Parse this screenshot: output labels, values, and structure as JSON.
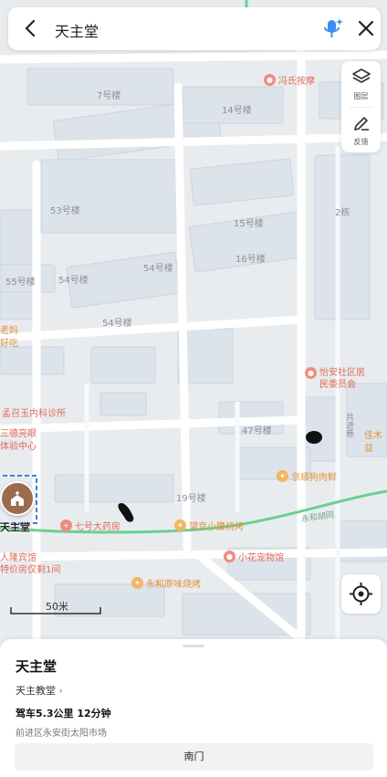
{
  "search": {
    "title": "天主堂"
  },
  "side_panel": {
    "layers_label": "图层",
    "feedback_label": "反馈"
  },
  "map": {
    "building_labels": [
      "7号楼",
      "14号楼",
      "53号楼",
      "15号楼",
      "2栋",
      "16号楼",
      "55号楼",
      "54号楼",
      "54号楼",
      "54号楼",
      "47号楼",
      "19号楼"
    ],
    "pois": [
      {
        "name": "冯氏按摩"
      },
      {
        "name": "怡安社区居\n民委员会"
      },
      {
        "name": "孟召玉内科诊所"
      },
      {
        "name": "三德亮眼\n体验中心"
      },
      {
        "name": "京顺狗肉鲜"
      },
      {
        "name": "七号大药房"
      },
      {
        "name": "望京小腰烧烤"
      },
      {
        "name": "小花宠物馆"
      },
      {
        "name": "永和原味烧烤"
      },
      {
        "name": "人隆宾馆\n特价房仅剩1间"
      },
      {
        "name": "老妈\n好吃"
      },
      {
        "name": "佳木\n益"
      }
    ],
    "roads": [
      "永和胡同",
      "共进巷"
    ],
    "selected_marker_label": "天主堂",
    "scale_text": "50米"
  },
  "sheet": {
    "title": "天主堂",
    "category": "天主教堂",
    "drive": "驾车5.3公里 12分钟",
    "address": "前进区永安街太阳市场",
    "gate_button": "南门"
  },
  "colors": {
    "route": "#6bd08f",
    "poi_red": "#e06a5a",
    "poi_orange": "#e0913a",
    "selected": "#3d7fd9"
  }
}
